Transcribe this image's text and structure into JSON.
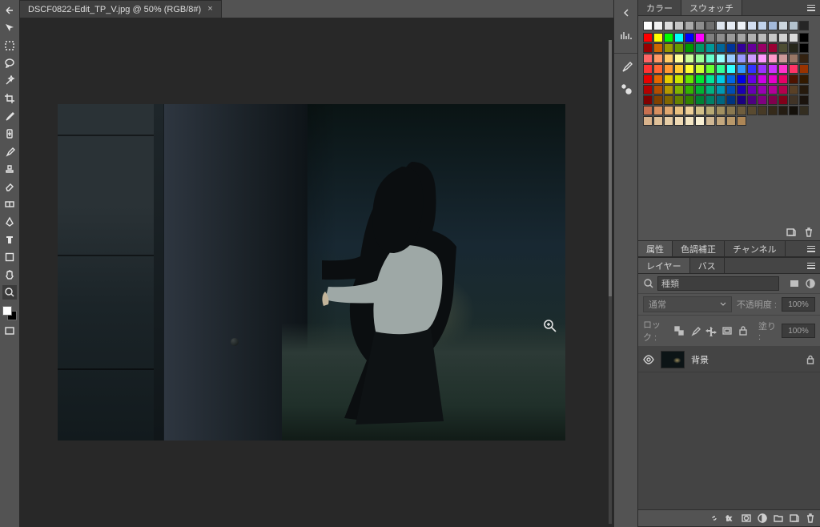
{
  "document": {
    "tab_label": "DSCF0822-Edit_TP_V.jpg @ 50% (RGB/8#)",
    "close_glyph": "×"
  },
  "panels": {
    "color_tab": "カラー",
    "swatches_tab": "スウォッチ",
    "properties_tab": "属性",
    "adjustments_tab": "色調補正",
    "channels_tab": "チャンネル",
    "layers_tab": "レイヤー",
    "paths_tab": "バス"
  },
  "swatches": {
    "gray_row": [
      "#ffffff",
      "#f1f1f1",
      "#dcdcdc",
      "#c4c4c4",
      "#aaaaaa",
      "#8d8d8d",
      "#6f6f6f",
      "#dfe6ef",
      "#e6ecf4",
      "#eff3f8",
      "#d2def0",
      "#c1d3ec",
      "#a3b9da",
      "#ccd6de",
      "#b3c2ce",
      "#252525"
    ],
    "colors": [
      [
        "#ff0000",
        "#ffff00",
        "#00ff00",
        "#00ffff",
        "#0000ff",
        "#ff00ff",
        "#808080",
        "#8e8e8e",
        "#9a9a9a",
        "#a5a5a5",
        "#b0b0b0",
        "#bbbbbb",
        "#c6c6c6",
        "#d1d1d1",
        "#dcdcdc",
        "#000000"
      ],
      [
        "#990000",
        "#cc6600",
        "#999900",
        "#669900",
        "#009900",
        "#009966",
        "#009999",
        "#006699",
        "#003399",
        "#330099",
        "#660099",
        "#990066",
        "#990033",
        "#4d4d33",
        "#26261a",
        "#000000"
      ],
      [
        "#ff6666",
        "#ff9966",
        "#ffcc66",
        "#ffff99",
        "#ccff99",
        "#99ff99",
        "#66ffcc",
        "#99ffff",
        "#99ccff",
        "#9999ff",
        "#cc99ff",
        "#ff99ff",
        "#ff99cc",
        "#cc9999",
        "#997766",
        "#332211"
      ],
      [
        "#ff3333",
        "#ff6633",
        "#ff9933",
        "#ffcc33",
        "#ffff33",
        "#ccff33",
        "#66ff33",
        "#33ff99",
        "#33ffff",
        "#3399ff",
        "#3333ff",
        "#9933ff",
        "#cc33ff",
        "#ff33cc",
        "#ff3366",
        "#993300"
      ],
      [
        "#e60000",
        "#e66600",
        "#e6cc00",
        "#cce600",
        "#66e600",
        "#00e633",
        "#00e699",
        "#00cce6",
        "#0066e6",
        "#0000e6",
        "#6600e6",
        "#cc00e6",
        "#e600cc",
        "#e60066",
        "#4d1300",
        "#331a00"
      ],
      [
        "#b30000",
        "#b34d00",
        "#b39900",
        "#80b300",
        "#33b300",
        "#00b333",
        "#00b380",
        "#0099b3",
        "#004db3",
        "#1a00b3",
        "#6600b3",
        "#9900b3",
        "#b30099",
        "#b3004d",
        "#594026",
        "#261a0d"
      ],
      [
        "#800000",
        "#804000",
        "#806600",
        "#668000",
        "#338000",
        "#008033",
        "#008066",
        "#006680",
        "#003380",
        "#1a0080",
        "#4d0080",
        "#800080",
        "#80004d",
        "#80001a",
        "#403326",
        "#1a130d"
      ],
      [
        "#c87050",
        "#d89060",
        "#e0a870",
        "#e8c080",
        "#eed098",
        "#d2c088",
        "#b8aa74",
        "#a29060",
        "#8a7850",
        "#6f5d3d",
        "#594a30",
        "#473a26",
        "#352a1a",
        "#241c12",
        "#14100a",
        "#332d20"
      ]
    ],
    "tint_row": [
      "#d9b38c",
      "#e0c199",
      "#e6cda6",
      "#eed9b3",
      "#f3e5c2",
      "#f8efd2",
      "#d0b894",
      "#c4a87e",
      "#b8986a",
      "#ad8656",
      "",
      "",
      "",
      "",
      "",
      ""
    ]
  },
  "layers": {
    "search_placeholder": "種類",
    "blend_mode": "通常",
    "opacity_label": "不透明度 :",
    "opacity_value": "100%",
    "lock_label": "ロック :",
    "fill_label": "塗り :",
    "fill_value": "100%",
    "layer_name": "背景"
  }
}
